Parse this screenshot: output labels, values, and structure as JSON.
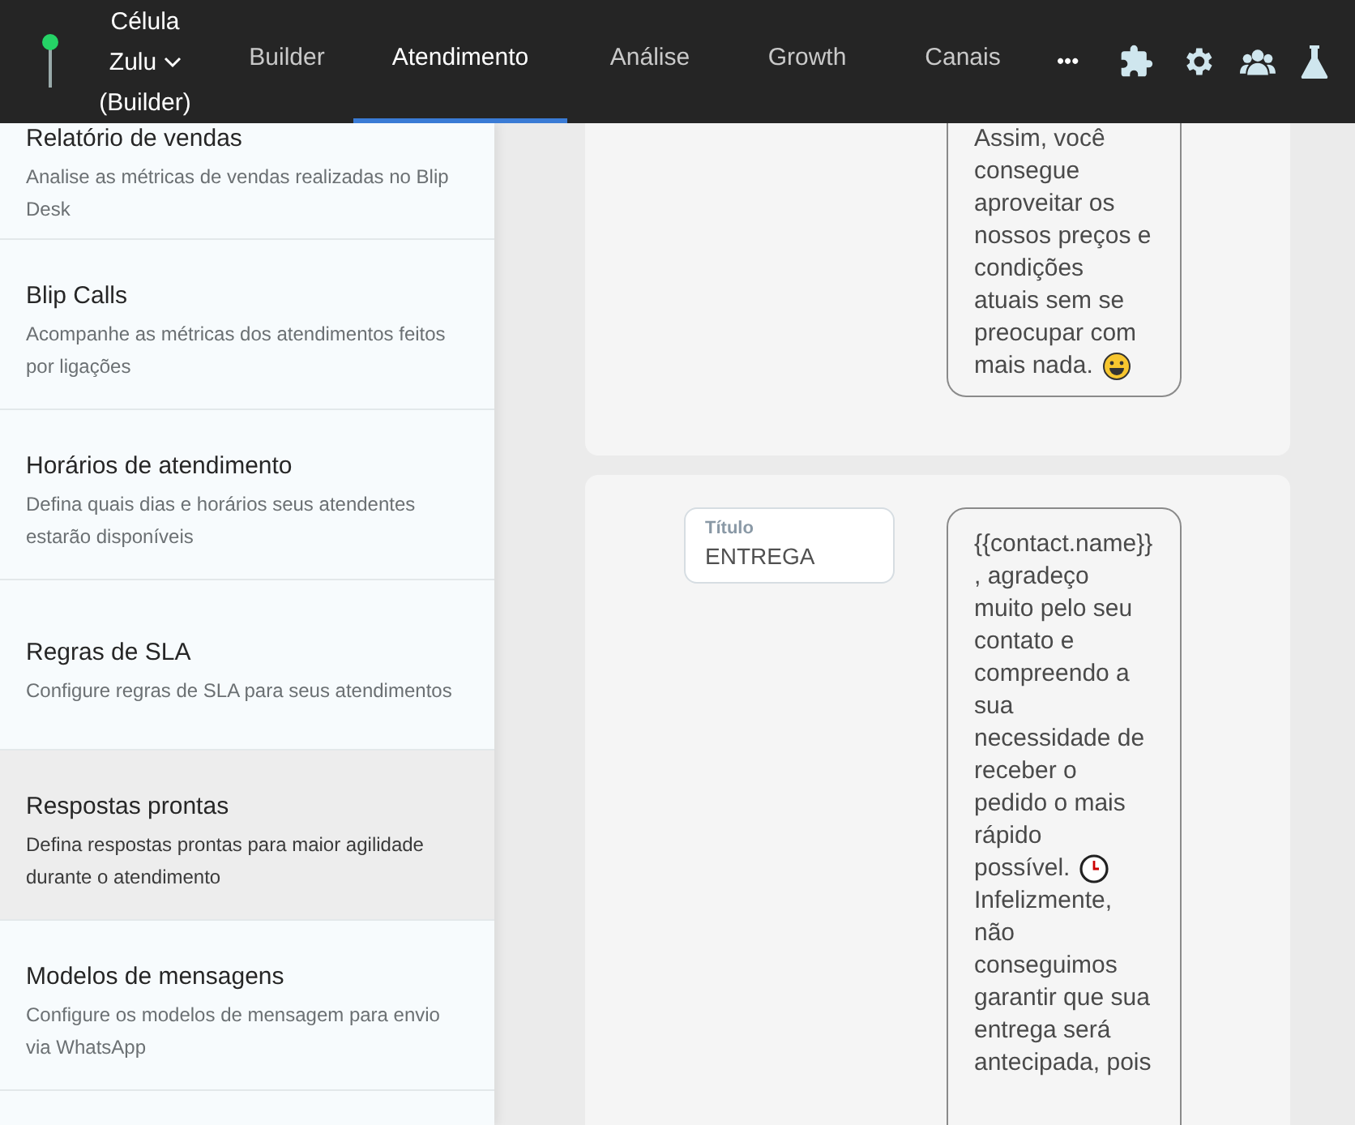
{
  "header": {
    "workspace": {
      "line1": "Célula",
      "line2": "Zulu",
      "line3": "(Builder)"
    },
    "tabs": [
      {
        "label": "Builder",
        "selected": false
      },
      {
        "label": "Atendimento",
        "selected": true
      },
      {
        "label": "Análise",
        "selected": false
      },
      {
        "label": "Growth",
        "selected": false
      },
      {
        "label": "Canais",
        "selected": false
      }
    ],
    "more": "•••"
  },
  "sidebar": {
    "items": [
      {
        "title": "Relatório de vendas",
        "description": "Analise as métricas de vendas realizadas no Blip Desk",
        "selected": false
      },
      {
        "title": "Blip Calls",
        "description": "Acompanhe as métricas dos atendimentos feitos por ligações",
        "selected": false
      },
      {
        "title": "Horários de atendimento",
        "description": "Defina quais dias e horários seus atendentes estarão disponíveis",
        "selected": false
      },
      {
        "title": "Regras de SLA",
        "description": "Configure regras de SLA para seus atendimentos",
        "selected": false
      },
      {
        "title": "Respostas prontas",
        "description": "Defina respostas prontas para maior agilidade durante o atendimento",
        "selected": true
      },
      {
        "title": "Modelos de mensagens",
        "description": "Configure os modelos de mensagem para envio via WhatsApp",
        "selected": false
      }
    ]
  },
  "replies": [
    {
      "message": [
        {
          "kind": "text",
          "text": "Assim, você consegue aproveitar os nossos preços e condições atuais sem se preocupar com"
        },
        {
          "kind": "smiley_line",
          "text": "mais nada."
        }
      ]
    },
    {
      "title_field": {
        "label": "Título",
        "value": "ENTREGA"
      },
      "message": [
        {
          "kind": "text",
          "text": "{{contact.name}}, agradeço muito pelo seu contato e compreendo a sua necessidade de receber o pedido o mais rápido"
        },
        {
          "kind": "clock_line",
          "text": "possível."
        },
        {
          "kind": "text",
          "text": "Infelizmente, não conseguimos garantir que sua entrega será antecipada, pois"
        }
      ]
    }
  ]
}
